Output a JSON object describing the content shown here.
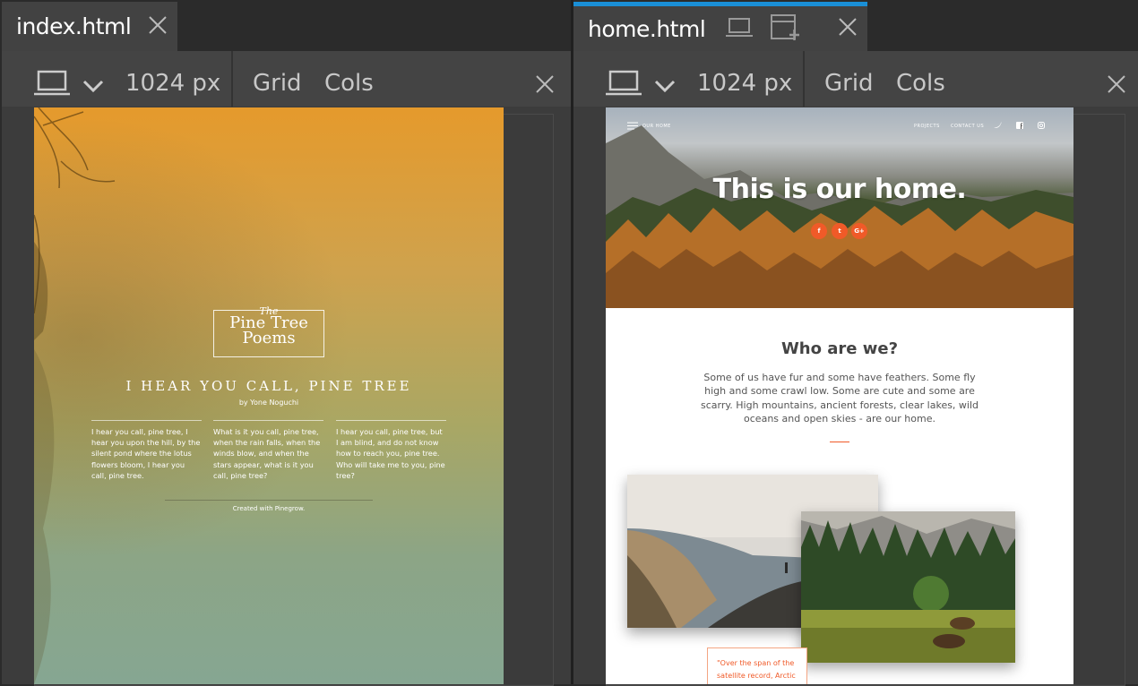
{
  "tabs": [
    {
      "label": "index.html"
    },
    {
      "label": "home.html"
    }
  ],
  "toolbar_left": {
    "device_icon": "laptop-icon",
    "width": "1024 px",
    "grid": "Grid",
    "cols": "Cols"
  },
  "toolbar_right": {
    "device_icon": "laptop-icon",
    "width": "1024 px",
    "grid": "Grid",
    "cols": "Cols"
  },
  "left_page": {
    "logo_the": "The",
    "logo_line1": "Pine Tree",
    "logo_line2": "Poems",
    "title": "I HEAR YOU CALL, PINE TREE",
    "byline": "by Yone Noguchi",
    "columns": [
      "I hear you call, pine tree, I hear you upon the hill, by the silent pond where the lotus flowers bloom, I hear you call, pine tree.",
      "What is it you call, pine tree, when the rain falls, when the winds blow, and when the stars appear, what is it you call, pine tree?",
      "I hear you call, pine tree, but I am blind, and do not know how to reach you, pine tree. Who will take me to you, pine tree?"
    ],
    "footer": "Created with Pinegrow."
  },
  "right_page": {
    "nav_brand": "OUR HOME",
    "nav_links": [
      "PROJECTS",
      "CONTACT US"
    ],
    "hero_title": "This is our home.",
    "social_buttons": [
      "f",
      "t",
      "G+"
    ],
    "who_title": "Who are we?",
    "who_text": "Some of us have fur and some have feathers. Some fly high and some crawl low. Some are cute and some are scarry. High mountains, ancient forests, clear lakes, wild oceans and open skies - are our home.",
    "quote_line1": "\"Over the span of the",
    "quote_line2": "satellite record, Arctic"
  },
  "colors": {
    "accent": "#f05a28",
    "tab_active_bar": "#1a8fd6"
  }
}
